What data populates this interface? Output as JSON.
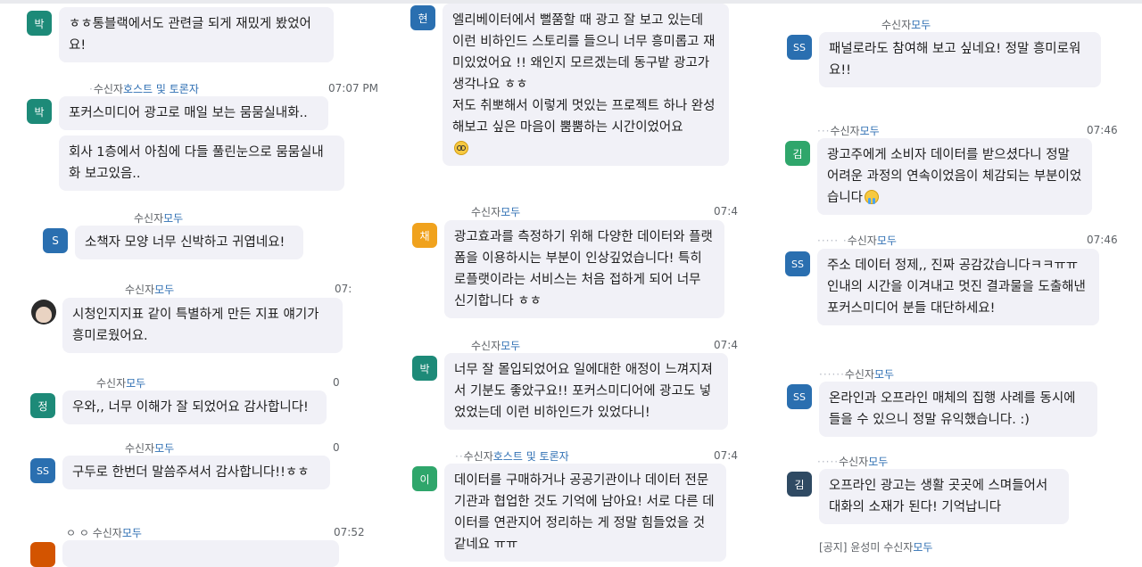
{
  "colors": {
    "bubble_bg": "#f1f1f7",
    "role_text": "#2f6fb3",
    "avatar_teal": "#1d8a78",
    "avatar_blue": "#2a6fb0",
    "avatar_orange": "#f0a21d",
    "avatar_green": "#2fa66b",
    "avatar_dark": "#2f4a63"
  },
  "icons": {
    "nerd": "nerd-face-emoji",
    "cry": "crying-face-emoji",
    "profile": "profile-photo-avatar"
  },
  "col1": [
    {
      "avatar": "박",
      "meta_prefix": "",
      "role": "",
      "time": "",
      "text": "ㅎㅎ통블랙에서도 관련글 되게 재밌게 봤었어요!"
    },
    {
      "avatar": "박",
      "meta_prefix": "수신자",
      "role": "호스트 및 토론자",
      "time": "07:07 PM",
      "text": "포커스미디어 광고로 매일 보는 뭄뭄실내화..",
      "text2": "회사 1층에서 아침에 다들 풀린눈으로 뭄뭄실내화 보고있음.."
    },
    {
      "avatar": "S",
      "meta_prefix": "수신자",
      "role": "모두",
      "time": "",
      "text": "소책자 모양 너무 신박하고 귀엽네요!"
    },
    {
      "avatar": "",
      "meta_prefix": "수신자",
      "role": "모두",
      "time": "07:",
      "text": "시청인지지표 같이 특별하게 만든 지표 얘기가 흥미로웠어요."
    },
    {
      "avatar": "정",
      "meta_prefix": "수신자",
      "role": "모두",
      "time": "0",
      "text": "우와,, 너무 이해가 잘 되었어요 감사합니다!"
    },
    {
      "avatar": "SS",
      "meta_prefix": "수신자",
      "role": "모두",
      "time": "0",
      "text": "구두로 한번더 말씀주셔서 감사합니다!!ㅎㅎ"
    },
    {
      "avatar": "",
      "meta_prefix": "ㅇ ㅇ 수신자",
      "role": "모두",
      "time": "07:52",
      "text": ""
    }
  ],
  "col2": [
    {
      "avatar": "현",
      "meta_prefix": "",
      "role": "",
      "time": "",
      "text": "엘리베이터에서 뻘쭘할 때 광고 잘 보고 있는데 이런 비하인드 스토리를 들으니 너무 흥미롭고 재미있었어요 !! 왜인지 모르겠는데 동구밭 광고가 생각나요 ㅎㅎ\n저도 취뽀해서 이렇게 멋있는 프로젝트 하나 완성해보고 싶은 마음이 뿜뿜하는 시간이었어요"
    },
    {
      "avatar": "채",
      "meta_prefix": "수신자",
      "role": "모두",
      "time": "07:4",
      "text": "광고효과를 측정하기 위해 다양한 데이터와 플랫폼을 이용하시는 부분이 인상깊었습니다! 특히 로플랫이라는 서비스는 처음 접하게 되어 너무 신기합니다 ㅎㅎ"
    },
    {
      "avatar": "박",
      "meta_prefix": "수신자",
      "role": "모두",
      "time": "07:4",
      "text": "너무 잘 몰입되었어요 일에대한 애정이 느껴지져서 기분도 좋았구요!! 포커스미디어에 광고도 넣었었는데 이런 비하인드가 있었다니!"
    },
    {
      "avatar": "이",
      "meta_prefix": "수신자",
      "role": "호스트 및 토론자",
      "time": "07:4",
      "text": "데이터를 구매하거나 공공기관이나 데이터 전문 기관과 협업한 것도 기억에 남아요! 서로 다른 데이터를 연관지어 정리하는 게 정말 힘들었을 것 같네요 ㅠㅠ"
    }
  ],
  "col3": [
    {
      "avatar": "SS",
      "meta_prefix": "수신자",
      "role": "모두",
      "time": "",
      "text": "패널로라도 참여해 보고 싶네요! 정말 흥미로워요!!"
    },
    {
      "avatar": "김",
      "meta_prefix": "수신자",
      "role": "모두",
      "time": "07:46",
      "text": "광고주에게 소비자 데이터를 받으셨다니 정말 어려운 과정의 연속이었음이 체감되는 부분이었습니다"
    },
    {
      "avatar": "SS",
      "meta_prefix": "수신자",
      "role": "모두",
      "time": "07:46",
      "text": "주소 데이터 정제,, 진짜 공감갔습니다ㅋㅋㅠㅠ 인내의 시간을 이겨내고 멋진 결과물을 도출해낸 포커스미디어 분들 대단하세요!"
    },
    {
      "avatar": "SS",
      "meta_prefix": "수신자",
      "role": "모두",
      "time": "",
      "text": "온라인과 오프라인 매체의 집행 사례를 동시에 들을 수 있으니 정말 유익했습니다. :)"
    },
    {
      "avatar": "김",
      "meta_prefix": "수신자",
      "role": "모두",
      "time": "",
      "text": "오프라인 광고는 생활 곳곳에 스며들어서 대화의 소재가 된다! 기억납니다"
    },
    {
      "avatar": "",
      "meta_prefix": "[공지] 윤성미 수신자",
      "role": "모두",
      "time": "",
      "text": ""
    }
  ]
}
